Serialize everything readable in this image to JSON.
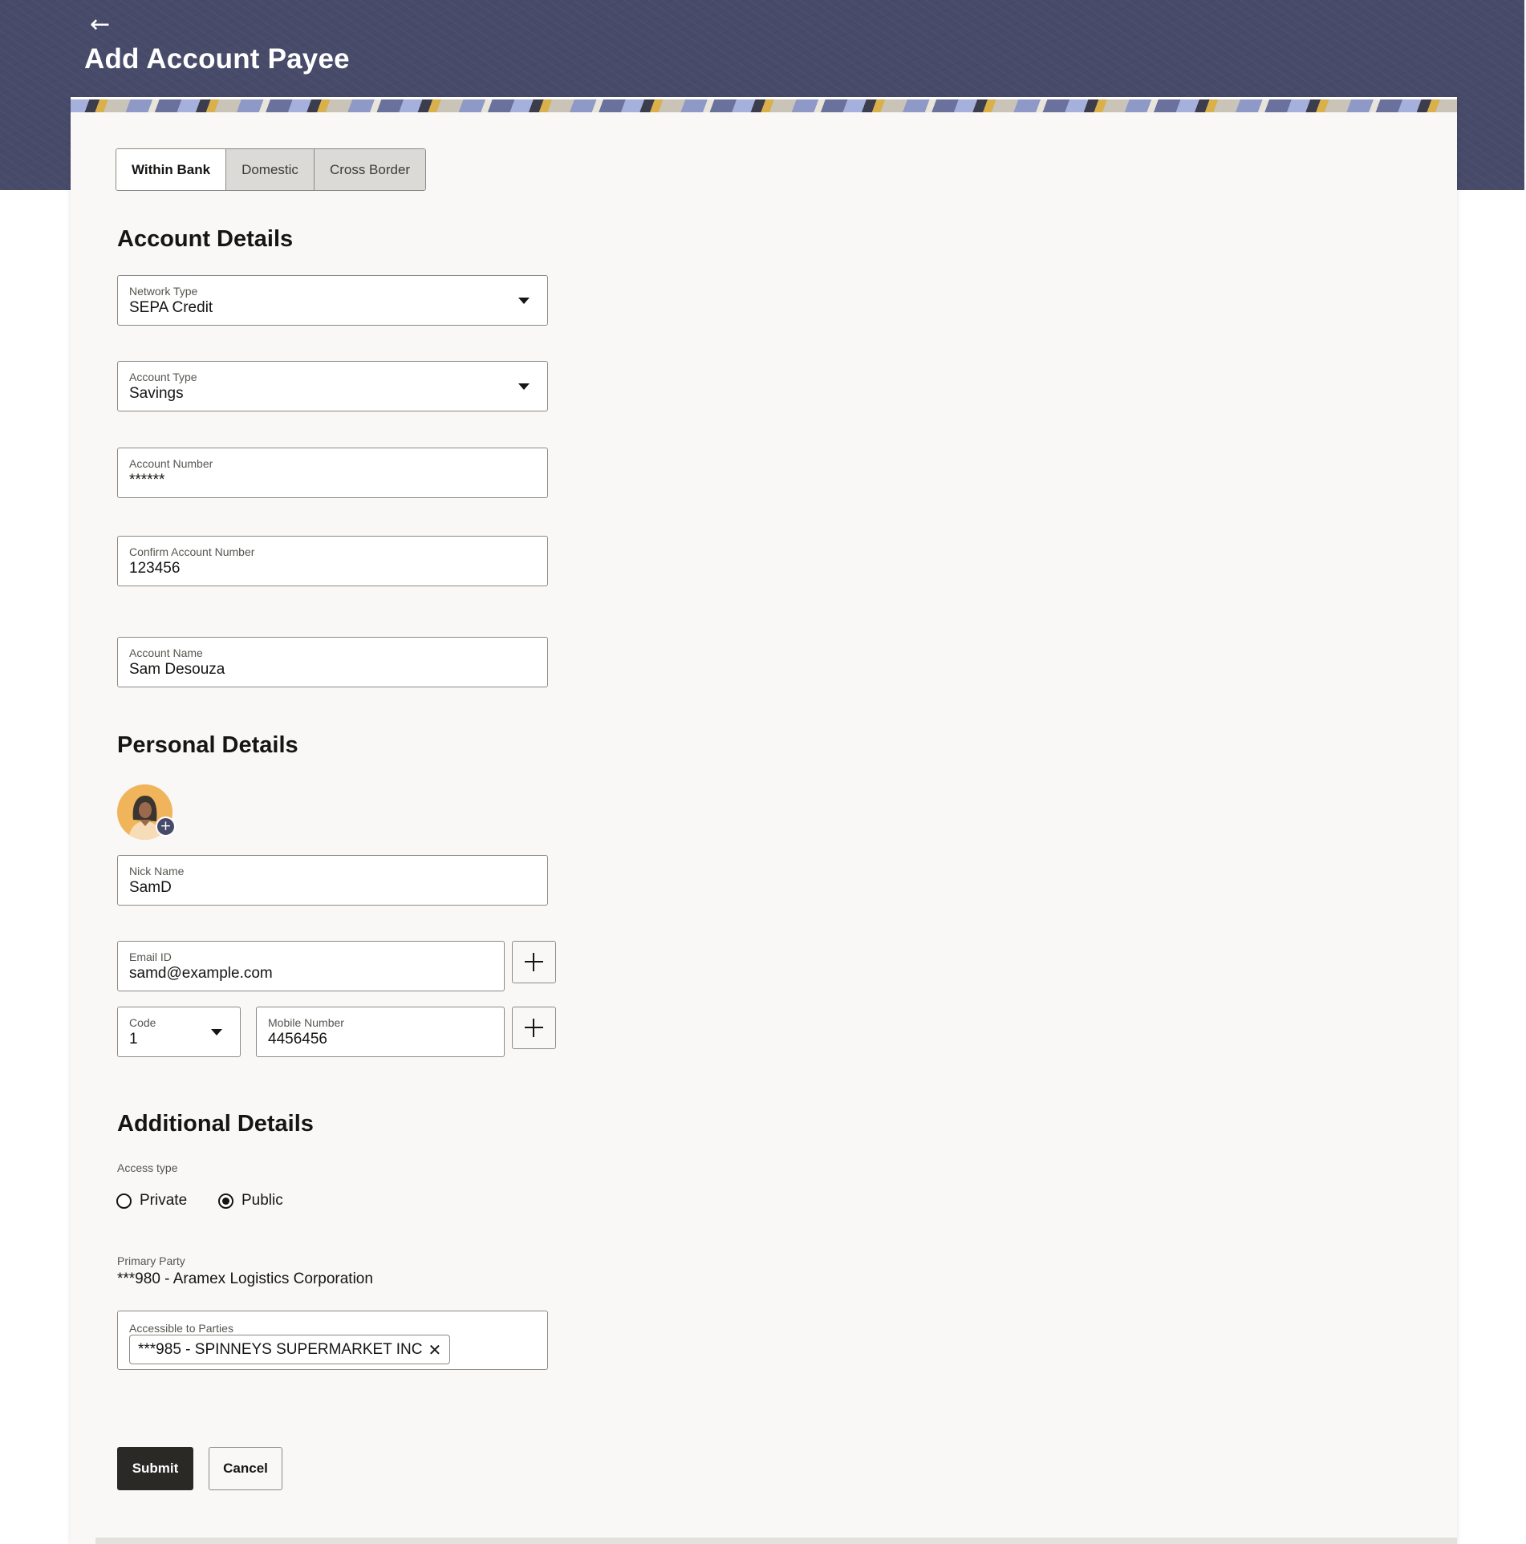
{
  "header": {
    "back_icon": "arrow-left-icon",
    "back_glyph": "←",
    "title": "Add Account Payee"
  },
  "tabs": [
    {
      "label": "Within Bank",
      "active": true
    },
    {
      "label": "Domestic",
      "active": false
    },
    {
      "label": "Cross Border",
      "active": false
    }
  ],
  "account_details": {
    "heading": "Account Details",
    "network_type": {
      "label": "Network Type",
      "value": "SEPA Credit"
    },
    "account_type": {
      "label": "Account Type",
      "value": "Savings"
    },
    "account_number": {
      "label": "Account Number",
      "value": "******"
    },
    "confirm_account_number": {
      "label": "Confirm Account Number",
      "value": "123456"
    },
    "account_name": {
      "label": "Account Name",
      "value": "Sam Desouza"
    }
  },
  "personal_details": {
    "heading": "Personal Details",
    "avatar_add_glyph": "+",
    "nick_name": {
      "label": "Nick Name",
      "value": "SamD"
    },
    "email": {
      "label": "Email ID",
      "value": "samd@example.com"
    },
    "code": {
      "label": "Code",
      "value": "1"
    },
    "mobile": {
      "label": "Mobile Number",
      "value": "4456456"
    }
  },
  "additional_details": {
    "heading": "Additional Details",
    "access_type_label": "Access type",
    "access_options": [
      {
        "label": "Private",
        "selected": false
      },
      {
        "label": "Public",
        "selected": true
      }
    ],
    "primary_party_label": "Primary Party",
    "primary_party_value": "***980 - Aramex Logistics Corporation",
    "accessible_label": "Accessible to Parties",
    "accessible_chip": "***985 - SPINNEYS SUPERMARKET INC",
    "chip_remove_glyph": "✕"
  },
  "actions": {
    "submit": "Submit",
    "cancel": "Cancel"
  },
  "colors": {
    "header_bg": "#474b69",
    "card_bg": "#f9f8f6",
    "primary_button": "#2b2926",
    "avatar_bg": "#f0b45a"
  }
}
